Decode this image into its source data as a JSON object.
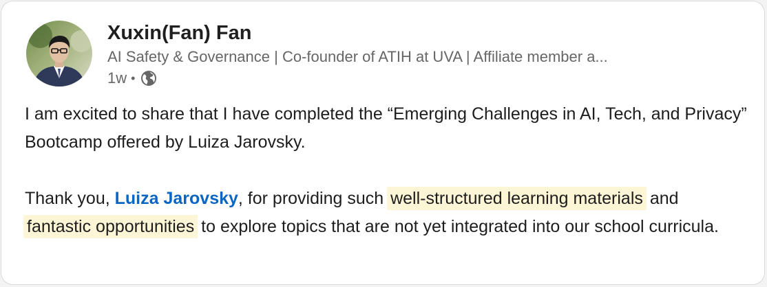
{
  "post": {
    "author": {
      "name": "Xuxin(Fan) Fan",
      "headline": "AI Safety & Governance | Co-founder of ATIH at UVA | Affiliate member a...",
      "time": "1w",
      "separator": "•",
      "visibility_icon": "globe-icon"
    },
    "body": {
      "p1": "I am excited to share that I have completed the “Emerging Challenges in AI, Tech, and Privacy” Bootcamp offered by Luiza Jarovsky.",
      "p2_a": "Thank you, ",
      "p2_mention": "Luiza Jarovsky",
      "p2_b": ", for providing such ",
      "p2_highlight1": "well-structured learning materials",
      "p2_c": " and ",
      "p2_highlight2": "fantastic opportunities",
      "p2_d": " to explore topics that are not yet integrated into our school curricula."
    }
  },
  "colors": {
    "mention": "#0a66c2",
    "highlight": "#fdf6d6",
    "secondary_text": "#666666"
  }
}
